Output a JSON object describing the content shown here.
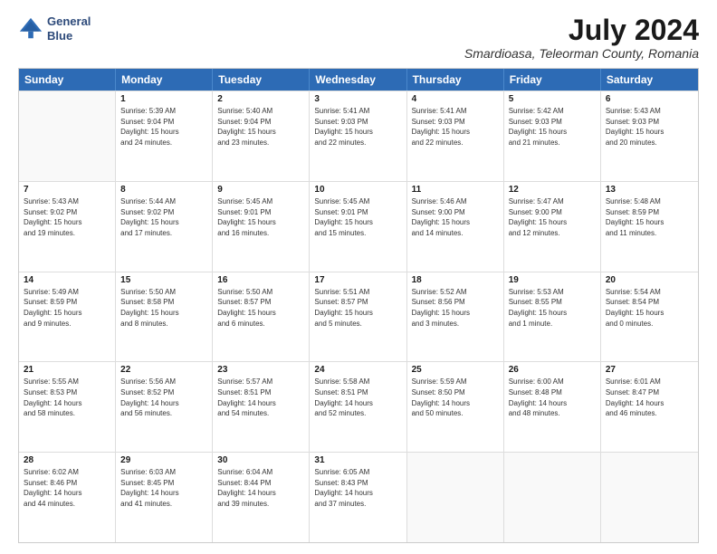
{
  "logo": {
    "line1": "General",
    "line2": "Blue"
  },
  "title": "July 2024",
  "subtitle": "Smardioasa, Teleorman County, Romania",
  "header_days": [
    "Sunday",
    "Monday",
    "Tuesday",
    "Wednesday",
    "Thursday",
    "Friday",
    "Saturday"
  ],
  "weeks": [
    [
      {
        "day": "",
        "text": ""
      },
      {
        "day": "1",
        "text": "Sunrise: 5:39 AM\nSunset: 9:04 PM\nDaylight: 15 hours\nand 24 minutes."
      },
      {
        "day": "2",
        "text": "Sunrise: 5:40 AM\nSunset: 9:04 PM\nDaylight: 15 hours\nand 23 minutes."
      },
      {
        "day": "3",
        "text": "Sunrise: 5:41 AM\nSunset: 9:03 PM\nDaylight: 15 hours\nand 22 minutes."
      },
      {
        "day": "4",
        "text": "Sunrise: 5:41 AM\nSunset: 9:03 PM\nDaylight: 15 hours\nand 22 minutes."
      },
      {
        "day": "5",
        "text": "Sunrise: 5:42 AM\nSunset: 9:03 PM\nDaylight: 15 hours\nand 21 minutes."
      },
      {
        "day": "6",
        "text": "Sunrise: 5:43 AM\nSunset: 9:03 PM\nDaylight: 15 hours\nand 20 minutes."
      }
    ],
    [
      {
        "day": "7",
        "text": "Sunrise: 5:43 AM\nSunset: 9:02 PM\nDaylight: 15 hours\nand 19 minutes."
      },
      {
        "day": "8",
        "text": "Sunrise: 5:44 AM\nSunset: 9:02 PM\nDaylight: 15 hours\nand 17 minutes."
      },
      {
        "day": "9",
        "text": "Sunrise: 5:45 AM\nSunset: 9:01 PM\nDaylight: 15 hours\nand 16 minutes."
      },
      {
        "day": "10",
        "text": "Sunrise: 5:45 AM\nSunset: 9:01 PM\nDaylight: 15 hours\nand 15 minutes."
      },
      {
        "day": "11",
        "text": "Sunrise: 5:46 AM\nSunset: 9:00 PM\nDaylight: 15 hours\nand 14 minutes."
      },
      {
        "day": "12",
        "text": "Sunrise: 5:47 AM\nSunset: 9:00 PM\nDaylight: 15 hours\nand 12 minutes."
      },
      {
        "day": "13",
        "text": "Sunrise: 5:48 AM\nSunset: 8:59 PM\nDaylight: 15 hours\nand 11 minutes."
      }
    ],
    [
      {
        "day": "14",
        "text": "Sunrise: 5:49 AM\nSunset: 8:59 PM\nDaylight: 15 hours\nand 9 minutes."
      },
      {
        "day": "15",
        "text": "Sunrise: 5:50 AM\nSunset: 8:58 PM\nDaylight: 15 hours\nand 8 minutes."
      },
      {
        "day": "16",
        "text": "Sunrise: 5:50 AM\nSunset: 8:57 PM\nDaylight: 15 hours\nand 6 minutes."
      },
      {
        "day": "17",
        "text": "Sunrise: 5:51 AM\nSunset: 8:57 PM\nDaylight: 15 hours\nand 5 minutes."
      },
      {
        "day": "18",
        "text": "Sunrise: 5:52 AM\nSunset: 8:56 PM\nDaylight: 15 hours\nand 3 minutes."
      },
      {
        "day": "19",
        "text": "Sunrise: 5:53 AM\nSunset: 8:55 PM\nDaylight: 15 hours\nand 1 minute."
      },
      {
        "day": "20",
        "text": "Sunrise: 5:54 AM\nSunset: 8:54 PM\nDaylight: 15 hours\nand 0 minutes."
      }
    ],
    [
      {
        "day": "21",
        "text": "Sunrise: 5:55 AM\nSunset: 8:53 PM\nDaylight: 14 hours\nand 58 minutes."
      },
      {
        "day": "22",
        "text": "Sunrise: 5:56 AM\nSunset: 8:52 PM\nDaylight: 14 hours\nand 56 minutes."
      },
      {
        "day": "23",
        "text": "Sunrise: 5:57 AM\nSunset: 8:51 PM\nDaylight: 14 hours\nand 54 minutes."
      },
      {
        "day": "24",
        "text": "Sunrise: 5:58 AM\nSunset: 8:51 PM\nDaylight: 14 hours\nand 52 minutes."
      },
      {
        "day": "25",
        "text": "Sunrise: 5:59 AM\nSunset: 8:50 PM\nDaylight: 14 hours\nand 50 minutes."
      },
      {
        "day": "26",
        "text": "Sunrise: 6:00 AM\nSunset: 8:48 PM\nDaylight: 14 hours\nand 48 minutes."
      },
      {
        "day": "27",
        "text": "Sunrise: 6:01 AM\nSunset: 8:47 PM\nDaylight: 14 hours\nand 46 minutes."
      }
    ],
    [
      {
        "day": "28",
        "text": "Sunrise: 6:02 AM\nSunset: 8:46 PM\nDaylight: 14 hours\nand 44 minutes."
      },
      {
        "day": "29",
        "text": "Sunrise: 6:03 AM\nSunset: 8:45 PM\nDaylight: 14 hours\nand 41 minutes."
      },
      {
        "day": "30",
        "text": "Sunrise: 6:04 AM\nSunset: 8:44 PM\nDaylight: 14 hours\nand 39 minutes."
      },
      {
        "day": "31",
        "text": "Sunrise: 6:05 AM\nSunset: 8:43 PM\nDaylight: 14 hours\nand 37 minutes."
      },
      {
        "day": "",
        "text": ""
      },
      {
        "day": "",
        "text": ""
      },
      {
        "day": "",
        "text": ""
      }
    ]
  ]
}
